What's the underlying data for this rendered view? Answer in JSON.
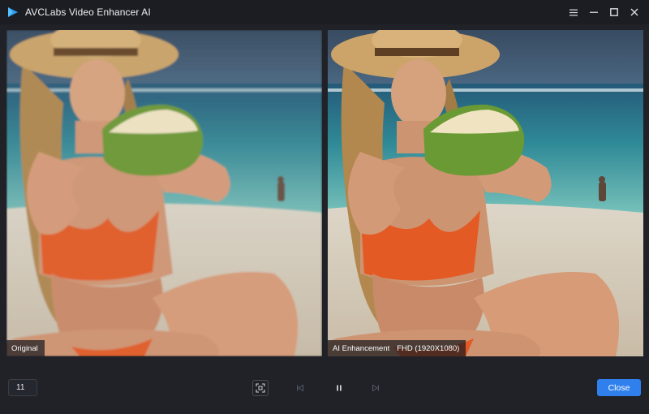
{
  "window": {
    "title": "AVCLabs Video Enhancer AI",
    "logo_icon": "play-triangle-logo-icon",
    "controls": [
      "menu-icon",
      "minimize-icon",
      "maximize-icon",
      "close-icon"
    ]
  },
  "preview": {
    "original_label": "Original",
    "enhanced_label": "AI Enhancement",
    "enhanced_resolution": "FHD (1920X1080)"
  },
  "playback": {
    "frame_value": "11",
    "buttons": [
      "fit-screen-icon",
      "previous-frame-icon",
      "pause-icon",
      "next-frame-icon"
    ],
    "close_label": "Close"
  },
  "colors": {
    "accent": "#2f80ed",
    "background": "#202228",
    "titlebar": "#1b1d22"
  }
}
